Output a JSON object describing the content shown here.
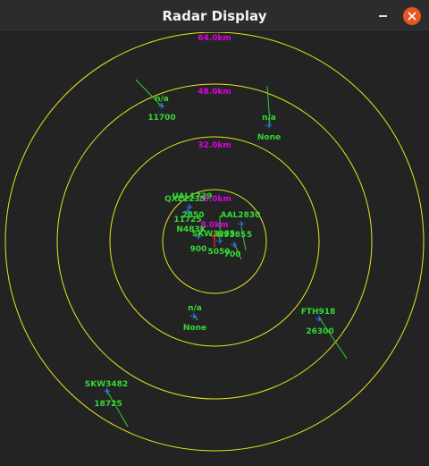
{
  "window": {
    "title": "Radar Display",
    "minimize_icon": "minimize-icon",
    "close_icon": "close-icon"
  },
  "colors": {
    "background": "#232323",
    "ring": "#e6e61e",
    "range_label": "#e000e0",
    "aircraft_label": "#33d933",
    "aircraft_symbol": "#2b7bff",
    "heading_line": "#33cc33",
    "center_marker": "#ff2a2a"
  },
  "radar": {
    "rings": [
      {
        "range_km": 8,
        "label": "8.0km"
      },
      {
        "range_km": 16,
        "label": "16.0km"
      },
      {
        "range_km": 32,
        "label": "32.0km"
      },
      {
        "range_km": 48,
        "label": "48.0km"
      },
      {
        "range_km": 64,
        "label": "64.0km"
      }
    ],
    "aircraft": [
      {
        "callsign": "n/a",
        "altitude": "11700"
      },
      {
        "callsign": "n/a",
        "altitude": "None"
      },
      {
        "callsign": "UAL1729",
        "altitude": "2850"
      },
      {
        "callsign": "QXE2235",
        "altitude": "11725"
      },
      {
        "callsign": "AAL2830",
        "altitude": "5050"
      },
      {
        "callsign": "N483K",
        "altitude": "900"
      },
      {
        "callsign": "SKW3935",
        "altitude": "700"
      },
      {
        "callsign": "N9385",
        "altitude": "5"
      },
      {
        "callsign": "n/a",
        "altitude": "None"
      },
      {
        "callsign": "FTH918",
        "altitude": "26300"
      },
      {
        "callsign": "SKW3482",
        "altitude": "18725"
      }
    ]
  }
}
